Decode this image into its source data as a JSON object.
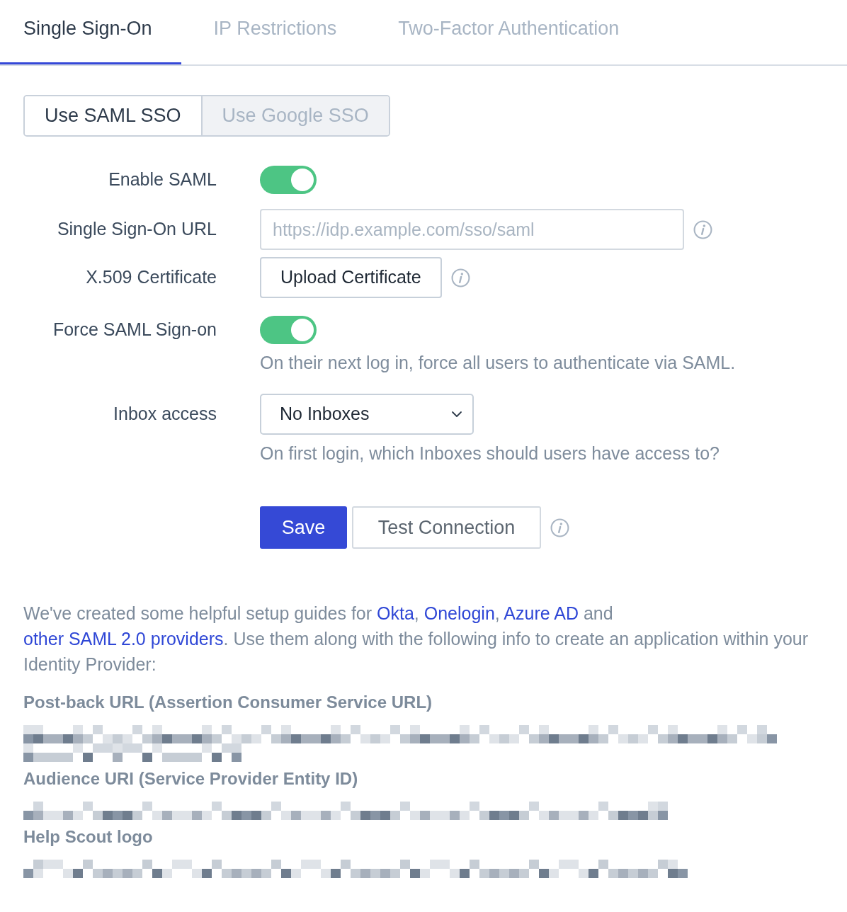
{
  "tabs": [
    {
      "label": "Single Sign-On",
      "selected": true
    },
    {
      "label": "IP Restrictions",
      "selected": false
    },
    {
      "label": "Two-Factor Authentication",
      "selected": false
    }
  ],
  "sso_type": [
    {
      "label": "Use SAML SSO",
      "selected": true
    },
    {
      "label": "Use Google SSO",
      "selected": false
    }
  ],
  "form": [
    {
      "kind": "toggle",
      "label": "Enable SAML",
      "on": true
    },
    {
      "kind": "text_input",
      "label": "Single Sign-On URL",
      "placeholder": "https://idp.example.com/sso/saml",
      "info": true
    },
    {
      "kind": "upload",
      "label": "X.509 Certificate",
      "button": "Upload Certificate",
      "info": true
    },
    {
      "kind": "toggle",
      "label": "Force SAML Sign-on",
      "on": true,
      "help": "On their next log in, force all users to authenticate via SAML."
    },
    {
      "kind": "select",
      "label": "Inbox access",
      "value": "No Inboxes",
      "help": "On first login, which Inboxes should users have access to?"
    }
  ],
  "actions": {
    "save": "Save",
    "test": "Test Connection",
    "info": true
  },
  "guide": {
    "segments": [
      {
        "kind": "text",
        "text": "We've created some helpful setup guides for "
      },
      {
        "kind": "link",
        "text": "Okta"
      },
      {
        "kind": "text",
        "text": ", "
      },
      {
        "kind": "link",
        "text": "Onelogin"
      },
      {
        "kind": "text",
        "text": ", "
      },
      {
        "kind": "link",
        "text": "Azure AD"
      },
      {
        "kind": "text",
        "text": " and "
      },
      {
        "kind": "link",
        "text": "other SAML 2.0 providers"
      },
      {
        "kind": "text",
        "text": ". Use them along with the following info to create an application within your Identity Provider:"
      }
    ]
  },
  "fields": [
    {
      "heading": "Post-back URL (Assertion Consumer Service URL)"
    },
    {
      "heading": "Audience URI (Service Provider Entity ID)"
    },
    {
      "heading": "Help Scout logo"
    }
  ]
}
